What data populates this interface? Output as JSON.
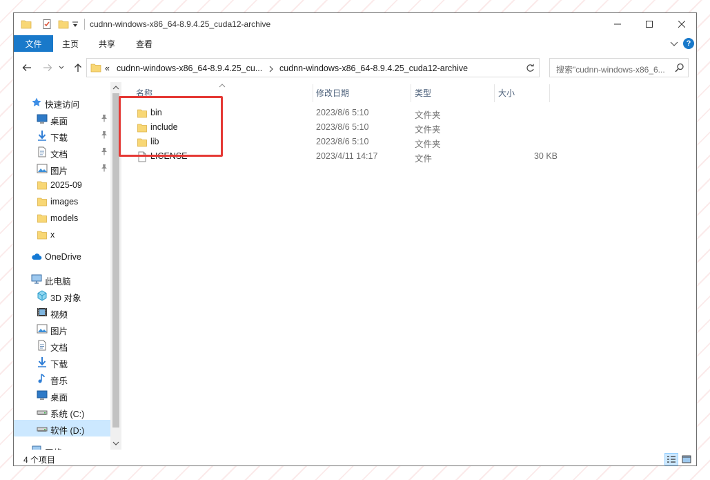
{
  "window": {
    "title": "cudnn-windows-x86_64-8.9.4.25_cuda12-archive"
  },
  "ribbon": {
    "tabs": [
      "文件",
      "主页",
      "共享",
      "查看"
    ]
  },
  "address": {
    "overflow_glyph": "«",
    "crumbs": [
      "cudnn-windows-x86_64-8.9.4.25_cu...",
      "cudnn-windows-x86_64-8.9.4.25_cuda12-archive"
    ]
  },
  "search": {
    "placeholder": "搜索\"cudnn-windows-x86_6..."
  },
  "columns": {
    "name": "名称",
    "date": "修改日期",
    "type": "类型",
    "size": "大小"
  },
  "files": [
    {
      "name": "bin",
      "date": "2023/8/6 5:10",
      "type": "文件夹",
      "size": "",
      "icon": "folder-icon"
    },
    {
      "name": "include",
      "date": "2023/8/6 5:10",
      "type": "文件夹",
      "size": "",
      "icon": "folder-icon"
    },
    {
      "name": "lib",
      "date": "2023/8/6 5:10",
      "type": "文件夹",
      "size": "",
      "icon": "folder-icon"
    },
    {
      "name": "LICENSE",
      "date": "2023/4/11 14:17",
      "type": "文件",
      "size": "30 KB",
      "icon": "file-icon"
    }
  ],
  "nav": {
    "quick_access": "快速访问",
    "quick_items": [
      {
        "label": "桌面",
        "icon": "desktop-icon",
        "pinned": true
      },
      {
        "label": "下载",
        "icon": "download-icon",
        "pinned": true
      },
      {
        "label": "文档",
        "icon": "document-icon",
        "pinned": true
      },
      {
        "label": "图片",
        "icon": "picture-icon",
        "pinned": true
      },
      {
        "label": "2025-09",
        "icon": "folder-icon",
        "pinned": false
      },
      {
        "label": "images",
        "icon": "folder-icon",
        "pinned": false
      },
      {
        "label": "models",
        "icon": "folder-icon",
        "pinned": false
      },
      {
        "label": "x",
        "icon": "folder-icon",
        "pinned": false
      }
    ],
    "onedrive": "OneDrive",
    "this_pc": "此电脑",
    "pc_items": [
      {
        "label": "3D 对象",
        "icon": "3d-objects-icon"
      },
      {
        "label": "视频",
        "icon": "video-icon"
      },
      {
        "label": "图片",
        "icon": "picture-icon"
      },
      {
        "label": "文档",
        "icon": "document-icon"
      },
      {
        "label": "下载",
        "icon": "download-icon"
      },
      {
        "label": "音乐",
        "icon": "music-icon"
      },
      {
        "label": "桌面",
        "icon": "desktop-icon"
      },
      {
        "label": "系统 (C:)",
        "icon": "drive-icon"
      },
      {
        "label": "软件 (D:)",
        "icon": "drive-icon",
        "selected": true
      }
    ],
    "network": "网络"
  },
  "status": {
    "item_count": "4 个项目"
  },
  "colors": {
    "accent": "#1979ca",
    "selection": "#cce8ff",
    "highlight_box": "#e53935",
    "folder": "#f8d775"
  }
}
